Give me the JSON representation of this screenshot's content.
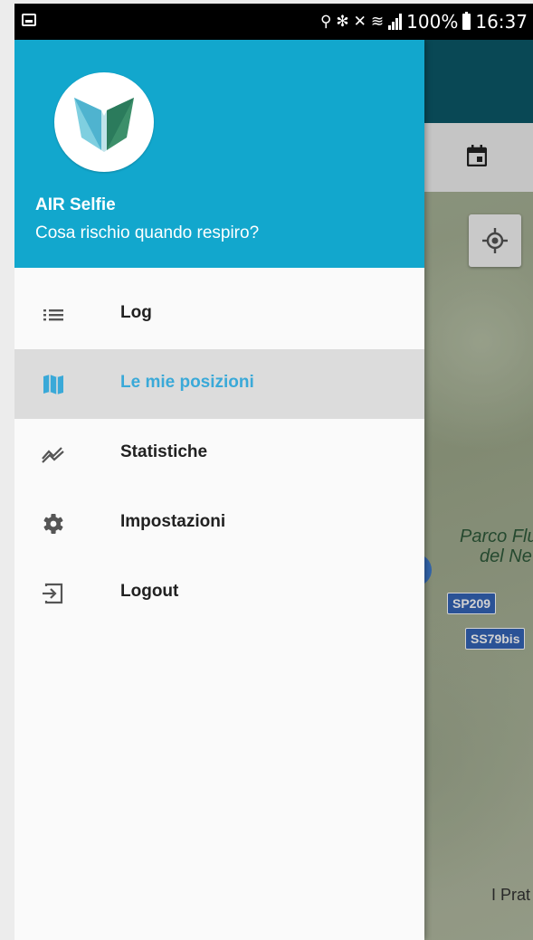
{
  "status_bar": {
    "battery": "100%",
    "time": "16:37"
  },
  "drawer": {
    "app_name": "AIR Selfie",
    "tagline": "Cosa rischio quando respiro?",
    "items": [
      {
        "label": "Log",
        "icon": "list-icon",
        "active": false
      },
      {
        "label": "Le mie posizioni",
        "icon": "map-icon",
        "active": true
      },
      {
        "label": "Statistiche",
        "icon": "trend-icon",
        "active": false
      },
      {
        "label": "Impostazioni",
        "icon": "gear-icon",
        "active": false
      },
      {
        "label": "Logout",
        "icon": "logout-icon",
        "active": false
      }
    ]
  },
  "map": {
    "park_label_line1": "Parco Flu",
    "park_label_line2": "del Ne",
    "road1": "SP209",
    "road2": "SS79bis",
    "town": "I Prat"
  },
  "colors": {
    "header": "#12a7cd",
    "toolbar": "#0b5868",
    "active_label": "#3aa9d8",
    "active_bg": "#dcdcdc"
  }
}
